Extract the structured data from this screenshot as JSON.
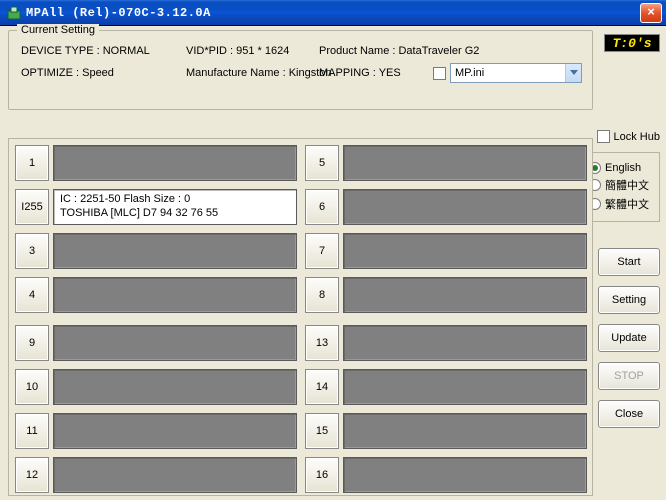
{
  "window": {
    "title": "MPAll (Rel)-070C-3.12.0A",
    "close_glyph": "×"
  },
  "timer": "T:0's",
  "setting": {
    "legend": "Current Setting",
    "device_type": "DEVICE TYPE : NORMAL",
    "vid_pid": "VID*PID : 951 * 1624",
    "product_name": "Product Name : DataTraveler G2",
    "optimize": "OPTIMIZE : Speed",
    "manufacturer": "Manufacture Name : Kingston",
    "mapping": "MAPPING : YES",
    "ini_file": "MP.ini"
  },
  "lockhub_label": "Lock Hub",
  "lang": {
    "en": "English",
    "cn_s": "簡體中文",
    "cn_t": "繁體中文"
  },
  "buttons": {
    "start": "Start",
    "setting": "Setting",
    "update": "Update",
    "stop": "STOP",
    "close": "Close"
  },
  "slots": {
    "left": [
      {
        "num": "1",
        "active": false,
        "line1": "",
        "line2": ""
      },
      {
        "num": "I255",
        "active": true,
        "line1": "IC : 2251-50  Flash Size : 0",
        "line2": "TOSHIBA [MLC] D7 94 32 76 55"
      },
      {
        "num": "3",
        "active": false,
        "line1": "",
        "line2": ""
      },
      {
        "num": "4",
        "active": false,
        "line1": "",
        "line2": ""
      },
      {
        "num": "9",
        "active": false,
        "line1": "",
        "line2": ""
      },
      {
        "num": "10",
        "active": false,
        "line1": "",
        "line2": ""
      },
      {
        "num": "11",
        "active": false,
        "line1": "",
        "line2": ""
      },
      {
        "num": "12",
        "active": false,
        "line1": "",
        "line2": ""
      }
    ],
    "right": [
      {
        "num": "5",
        "active": false,
        "line1": "",
        "line2": ""
      },
      {
        "num": "6",
        "active": false,
        "line1": "",
        "line2": ""
      },
      {
        "num": "7",
        "active": false,
        "line1": "",
        "line2": ""
      },
      {
        "num": "8",
        "active": false,
        "line1": "",
        "line2": ""
      },
      {
        "num": "13",
        "active": false,
        "line1": "",
        "line2": ""
      },
      {
        "num": "14",
        "active": false,
        "line1": "",
        "line2": ""
      },
      {
        "num": "15",
        "active": false,
        "line1": "",
        "line2": ""
      },
      {
        "num": "16",
        "active": false,
        "line1": "",
        "line2": ""
      }
    ]
  }
}
